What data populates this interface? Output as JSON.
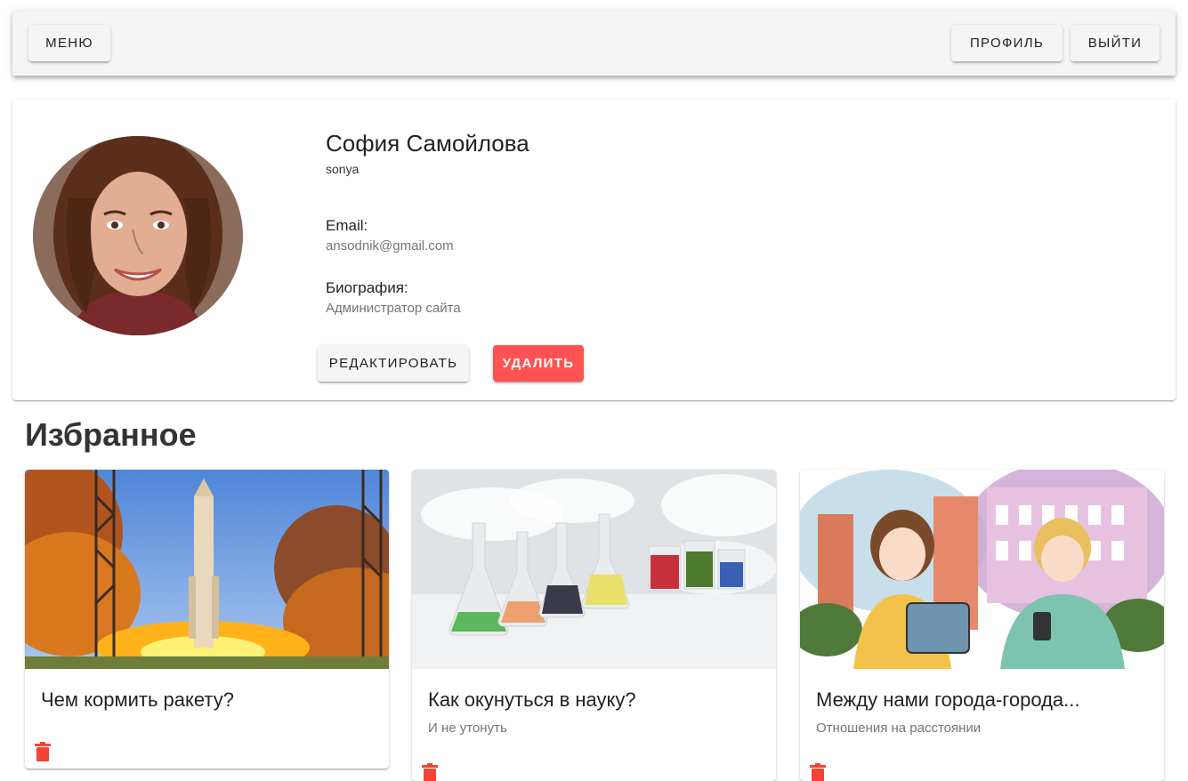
{
  "toolbar": {
    "menu_label": "Меню",
    "profile_label": "Профиль",
    "logout_label": "Выйти"
  },
  "profile": {
    "name": "София Самойлова",
    "username": "sonya",
    "email_label": "Email:",
    "email": "ansodnik@gmail.com",
    "bio_label": "Биография:",
    "bio": "Администратор сайта",
    "edit_label": "Редактировать",
    "delete_label": "Удалить"
  },
  "favorites": {
    "title": "Избранное",
    "items": [
      {
        "title": "Чем кормить ракету?",
        "subtitle": "",
        "image": "rocket-launch-image"
      },
      {
        "title": "Как окунуться в науку?",
        "subtitle": "И не утонуть",
        "image": "chemistry-flasks-image"
      },
      {
        "title": "Между нами города-города...",
        "subtitle": "Отношения на расстоянии",
        "image": "watercolor-couple-image"
      }
    ]
  },
  "colors": {
    "danger": "#ff5252",
    "toolbar_bg": "#f5f5f5",
    "trash_icon": "#f44336"
  }
}
